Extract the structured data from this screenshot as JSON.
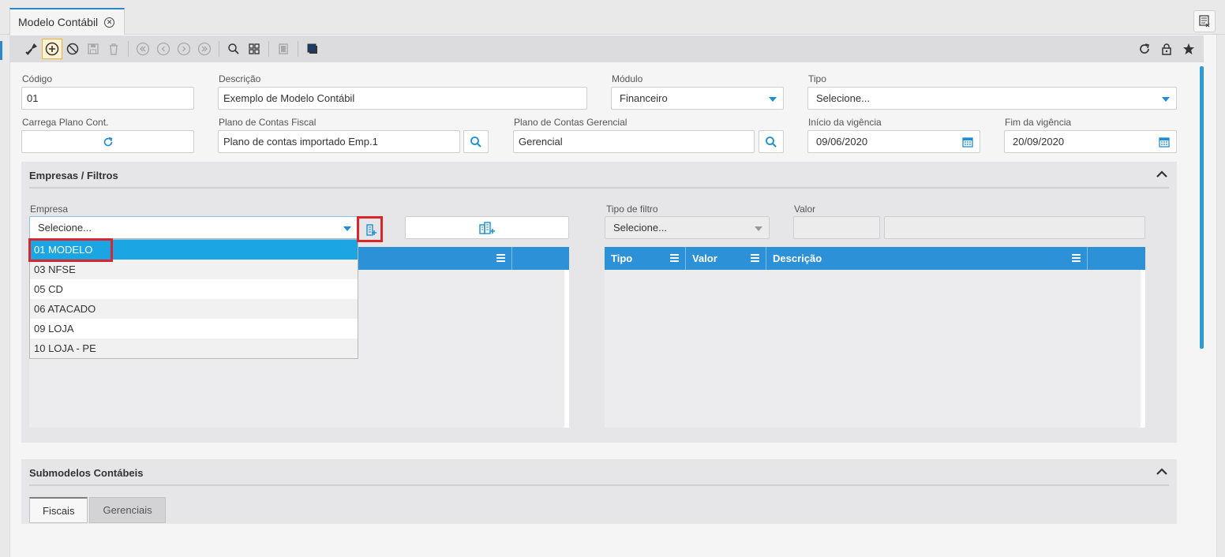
{
  "tab": {
    "title": "Modelo Contábil",
    "close_icon": "close-circle-icon"
  },
  "form": {
    "codigo": {
      "label": "Código",
      "value": "01"
    },
    "descricao": {
      "label": "Descrição",
      "value": "Exemplo de Modelo Contábil"
    },
    "modulo": {
      "label": "Módulo",
      "value": "Financeiro"
    },
    "tipo": {
      "label": "Tipo",
      "value": "Selecione..."
    },
    "carrega_plano": {
      "label": "Carrega Plano Cont."
    },
    "plano_fiscal": {
      "label": "Plano de Contas Fiscal",
      "value": "Plano de contas importado Emp.1"
    },
    "plano_gerencial": {
      "label": "Plano de Contas Gerencial",
      "value": "Gerencial"
    },
    "inicio_vigencia": {
      "label": "Início da vigência",
      "value": "09/06/2020"
    },
    "fim_vigencia": {
      "label": "Fim da vigência",
      "value": "20/09/2020"
    }
  },
  "empresas_section": {
    "title": "Empresas / Filtros",
    "empresa_label": "Empresa",
    "empresa_value": "Selecione...",
    "tipo_filtro_label": "Tipo de filtro",
    "tipo_filtro_value": "Selecione...",
    "valor_label": "Valor",
    "filter_grid_columns": [
      "Tipo",
      "Valor",
      "Descrição"
    ],
    "dropdown_options": [
      "01 MODELO",
      "03 NFSE",
      "05 CD",
      "06 ATACADO",
      "09 LOJA",
      "10 LOJA - PE"
    ]
  },
  "submodelos_section": {
    "title": "Submodelos Contábeis",
    "tabs": [
      "Fiscais",
      "Gerenciais"
    ]
  },
  "colors": {
    "accent": "#2d91d8",
    "selected": "#1ba5e3",
    "highlight": "#d9262c"
  }
}
